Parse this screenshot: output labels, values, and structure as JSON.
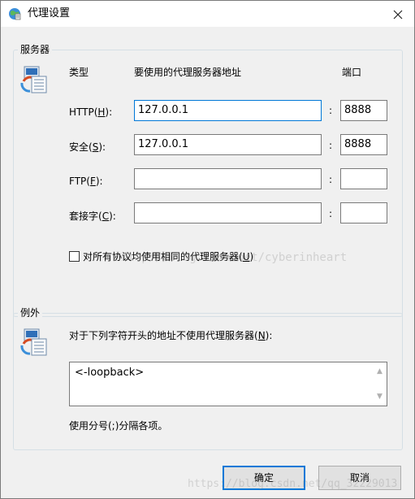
{
  "window": {
    "title": "代理设置"
  },
  "servers": {
    "legend": "服务器",
    "col_type": "类型",
    "col_address": "要使用的代理服务器地址",
    "col_port": "端口",
    "rows": [
      {
        "label_prefix": "HTTP(",
        "mnemonic": "H",
        "label_suffix": "):",
        "address": "127.0.0.1",
        "sep": ":",
        "port": "8888"
      },
      {
        "label_prefix": "安全(",
        "mnemonic": "S",
        "label_suffix": "):",
        "address": "127.0.0.1",
        "sep": ":",
        "port": "8888"
      },
      {
        "label_prefix": "FTP(",
        "mnemonic": "F",
        "label_suffix": "):",
        "address": "",
        "sep": ":",
        "port": ""
      },
      {
        "label_prefix": "套接字(",
        "mnemonic": "C",
        "label_suffix": "):",
        "address": "",
        "sep": ":",
        "port": ""
      }
    ],
    "same_proxy": {
      "label_prefix": "对所有协议均使用相同的代理服务器(",
      "mnemonic": "U",
      "label_suffix": ")",
      "checked": false
    }
  },
  "exceptions": {
    "legend": "例外",
    "description_prefix": "对于下列字符开头的地址不使用代理服务器(",
    "description_mnemonic": "N",
    "description_suffix": "):",
    "value": "<-loopback>",
    "hint": "使用分号(;)分隔各项。"
  },
  "buttons": {
    "ok": "确定",
    "cancel": "取消"
  },
  "watermark": {
    "line1": "http://blog.csdn.net/cyberinheart",
    "line2": "https://blog.csdn.net/qq_32229013"
  },
  "colors": {
    "accent": "#0078d7",
    "dialog_bg": "#f0f0f0",
    "group_border": "#d5dfe5"
  }
}
